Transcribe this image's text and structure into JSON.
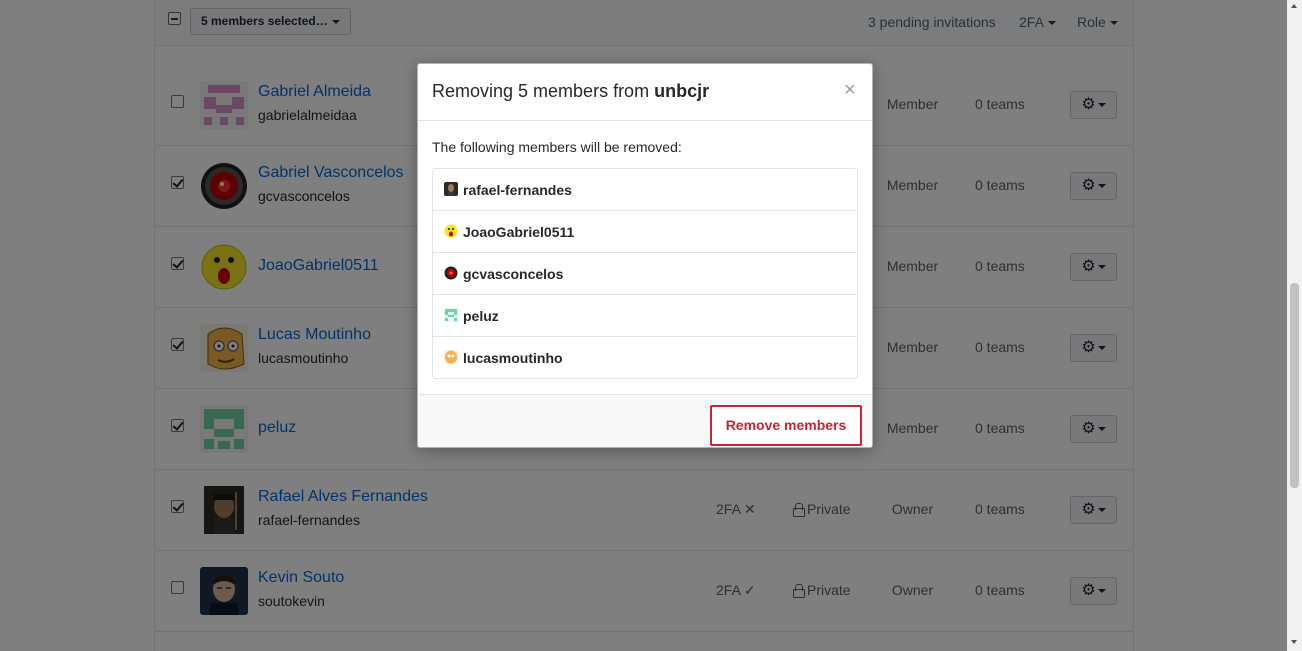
{
  "toolbar": {
    "selected_label": "5 members selected…",
    "pending_invitations": "3 pending invitations",
    "filter_2fa": "2FA",
    "filter_role": "Role"
  },
  "members": [
    {
      "fullname": "Gabriel Almeida",
      "login": "gabrielalmeidaa",
      "checked": false,
      "tfa": "",
      "privacy": "",
      "role": "Member",
      "teams": "0 teams",
      "avatar": "pink-identicon"
    },
    {
      "fullname": "Gabriel Vasconcelos",
      "login": "gcvasconcelos",
      "checked": true,
      "tfa": "",
      "privacy": "",
      "role": "Member",
      "teams": "0 teams",
      "avatar": "hal-eye"
    },
    {
      "fullname": "JoaoGabriel0511",
      "login": "",
      "checked": true,
      "tfa": "",
      "privacy": "",
      "role": "Member",
      "teams": "0 teams",
      "avatar": "yellow-face"
    },
    {
      "fullname": "Lucas Moutinho",
      "login": "lucasmoutinho",
      "checked": true,
      "tfa": "",
      "privacy": "",
      "role": "Member",
      "teams": "0 teams",
      "avatar": "cartoon-face"
    },
    {
      "fullname": "peluz",
      "login": "",
      "checked": true,
      "tfa": "",
      "privacy": "",
      "role": "Member",
      "teams": "0 teams",
      "avatar": "green-identicon"
    },
    {
      "fullname": "Rafael Alves Fernandes",
      "login": "rafael-fernandes",
      "checked": true,
      "tfa": "2FA ✕",
      "privacy": "Private",
      "role": "Owner",
      "teams": "0 teams",
      "avatar": "photo"
    },
    {
      "fullname": "Kevin Souto",
      "login": "soutokevin",
      "checked": false,
      "tfa": "2FA ✓",
      "privacy": "Private",
      "role": "Owner",
      "teams": "0 teams",
      "avatar": "photo"
    }
  ],
  "modal": {
    "title_prefix": "Removing 5 members from ",
    "org_name": "unbcjr",
    "close_symbol": "×",
    "intro": "The following members will be removed:",
    "removed": [
      "rafael-fernandes",
      "JoaoGabriel0511",
      "gcvasconcelos",
      "peluz",
      "lucasmoutinho"
    ],
    "confirm_label": "Remove members"
  },
  "colors": {
    "link": "#0366d6",
    "danger": "#cb2431",
    "backdrop": "rgba(0,0,0,0.5)"
  }
}
